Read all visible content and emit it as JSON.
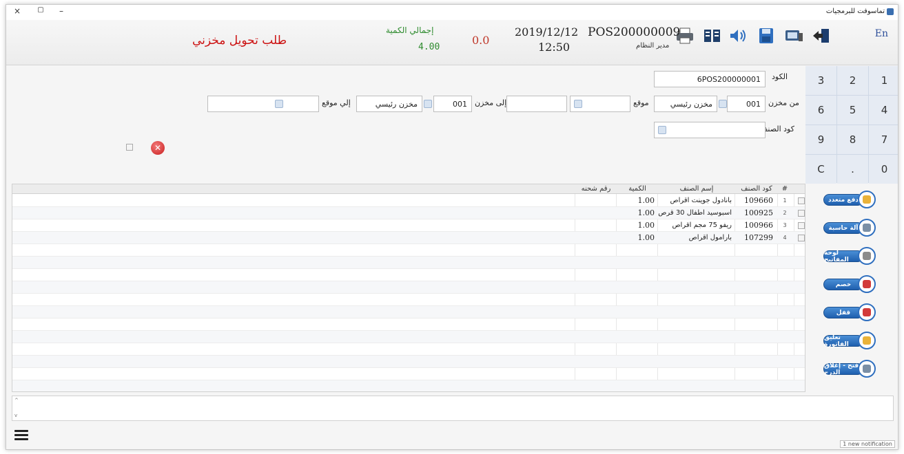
{
  "window": {
    "title": "تماسوفت للبرمجيات",
    "controls": {
      "close": "×",
      "restore": "▢",
      "minimize": "–"
    }
  },
  "header": {
    "lang": "En",
    "pos_number": "POS200000009",
    "user": "مدير النظام",
    "date": "2019/12/12",
    "time": "12:50",
    "amount": "0.0",
    "qty_label": "إجمالي الكمية",
    "qty_value": "4.00",
    "page_title": "طلب تحويل مخزني",
    "icons": [
      "exit-icon",
      "monitor-icon",
      "save-icon",
      "sound-icon",
      "barcode-icon",
      "printer-icon"
    ]
  },
  "numpad": [
    "1",
    "2",
    "3",
    "4",
    "5",
    "6",
    "7",
    "8",
    "9",
    "0",
    ".",
    "C"
  ],
  "form": {
    "code_label": "الكود",
    "code_value": "6POS200000001",
    "from_store_label": "من مخزن",
    "from_store_code": "001",
    "from_store_name": "مخزن رئيسي",
    "from_location_label": "موقع",
    "from_location_value": "",
    "to_store_label": "إلى مخزن",
    "to_store_code": "001",
    "to_store_name": "مخزن رئيسي",
    "to_location_label": "إلي موقع",
    "to_location_value": "",
    "item_code_label": "كود الصنف",
    "item_code_value": ""
  },
  "grid": {
    "columns": {
      "num": "#",
      "code": "كود الصنف",
      "name": "إسم الصنف",
      "qty": "الكمية",
      "batch": "رقم شحنه"
    },
    "rows": [
      {
        "n": "1",
        "code": "109660",
        "name": "بانادول جوينت اقراص",
        "qty": "1.00",
        "batch": ""
      },
      {
        "n": "2",
        "code": "100925",
        "name": "اسبوسيد اطفال 30 قرص",
        "qty": "1.00",
        "batch": ""
      },
      {
        "n": "3",
        "code": "100966",
        "name": "ريفو 75 مجم اقراص",
        "qty": "1.00",
        "batch": ""
      },
      {
        "n": "4",
        "code": "107299",
        "name": "بارامول اقراص",
        "qty": "1.00",
        "batch": ""
      }
    ]
  },
  "sidebar": {
    "buttons": [
      {
        "label": "دفع متعدد",
        "icon": "coins-icon",
        "color": "#e9b23a"
      },
      {
        "label": "آلة حاسبة",
        "icon": "calculator-icon",
        "color": "#7a8fa6"
      },
      {
        "label": "لوحة المفاتيح",
        "icon": "keyboard-icon",
        "color": "#8c8c8c"
      },
      {
        "label": "خصم",
        "icon": "discount-icon",
        "color": "#d23a3a"
      },
      {
        "label": "قفل",
        "icon": "lock-icon",
        "color": "#d23a3a"
      },
      {
        "label": "تعليق الفاتورة",
        "icon": "pause-icon",
        "color": "#e9b23a"
      },
      {
        "label": "فتح - إغلاق الدرج",
        "icon": "drawer-icon",
        "color": "#7a8fa6"
      }
    ]
  },
  "memo": {
    "up": "^",
    "down": "v"
  },
  "notification": "1 new notification"
}
